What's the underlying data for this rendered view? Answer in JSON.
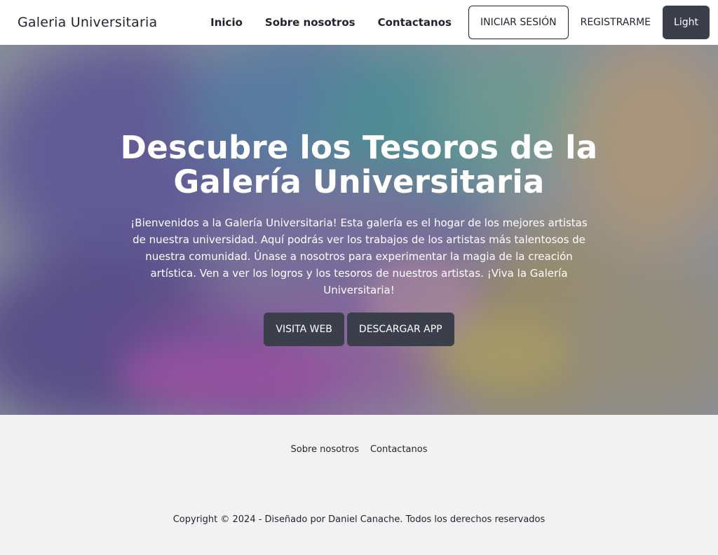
{
  "navbar": {
    "brand": "Galeria Universitaria",
    "links": [
      "Inicio",
      "Sobre nosotros",
      "Contactanos"
    ],
    "login_label": "INICIAR SESIÓN",
    "register_label": "REGISTRARME",
    "theme_label": "Light"
  },
  "hero": {
    "title": "Descubre los Tesoros de la Galería Universitaria",
    "text": "¡Bienvenidos a la Galería Universitaria! Esta galería es el hogar de los mejores artistas de nuestra universidad. Aquí podrás ver los trabajos de los artistas más talentosos de nuestra comunidad. Únase a nosotros para experimentar la magia de la creación artística. Ven a ver los logros y los tesoros de nuestros artistas. ¡Viva la Galería Universitaria!",
    "visit_label": "VISITA WEB",
    "download_label": "DESCARGAR APP"
  },
  "footer": {
    "links": [
      "Sobre nosotros",
      "Contactanos"
    ],
    "copyright": "Copyright © 2024 - Diseñado por Daniel Canache. Todos los derechos reservados"
  },
  "colors": {
    "dark_button": "#3a3f4b",
    "text": "#1f2430",
    "footer_bg": "#f2f2f2"
  }
}
